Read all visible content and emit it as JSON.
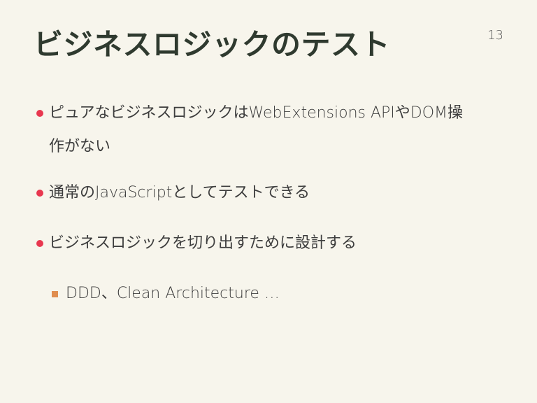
{
  "slide": {
    "title": "ビジネスロジックのテスト",
    "page_number": "13",
    "bullets": [
      {
        "text": "ピュアなビジネスロジックはWebExtensions APIやDOM操作がない"
      },
      {
        "text": "通常のJavaScriptとしてテストできる"
      },
      {
        "text": "ビジネスロジックを切り出すために設計する"
      }
    ],
    "sub_bullets": [
      {
        "text": "DDD、Clean Architecture …"
      }
    ],
    "colors": {
      "background": "#f7f5ec",
      "title": "#2f3a2f",
      "bullet_dot": "#e8374f",
      "sub_bullet_square": "#e08d4f"
    }
  }
}
